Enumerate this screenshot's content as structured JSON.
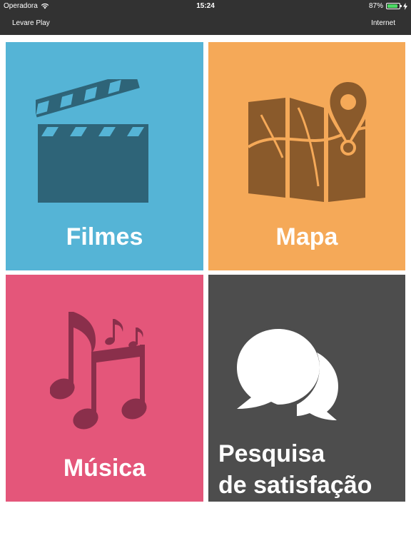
{
  "status_bar": {
    "carrier": "Operadora",
    "time": "15:24",
    "battery_percent": "87%",
    "battery_level": 0.87
  },
  "nav": {
    "left_label": "Levare Play",
    "right_label": "Internet"
  },
  "tiles": [
    {
      "label": "Filmes",
      "color": "#55b4d6",
      "icon": "clapperboard-icon"
    },
    {
      "label": "Mapa",
      "color": "#f5a958",
      "icon": "map-pin-icon"
    },
    {
      "label": "Música",
      "color": "#e4567a",
      "icon": "music-notes-icon"
    },
    {
      "label_line1": "Pesquisa",
      "label_line2": "de satisfação",
      "color": "#4d4d4d",
      "icon": "speech-bubbles-icon"
    }
  ]
}
